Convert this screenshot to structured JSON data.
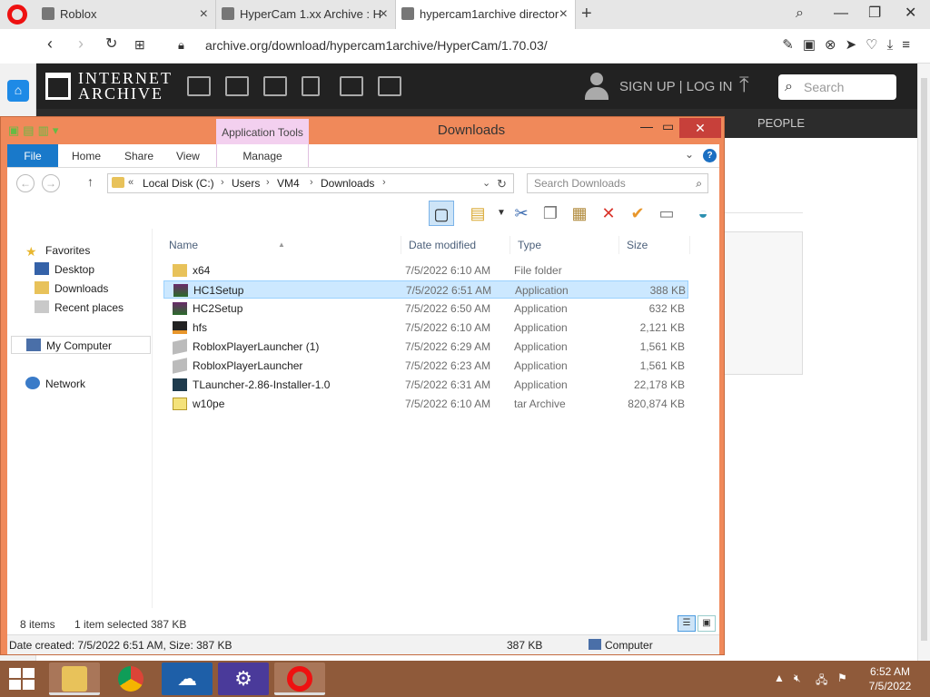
{
  "browser": {
    "tabs": [
      {
        "title": "Roblox",
        "active": false
      },
      {
        "title": "HyperCam 1.xx Archive : H",
        "active": false
      },
      {
        "title": "hypercam1archive director",
        "active": true
      }
    ],
    "url": "archive.org/download/hypercam1archive/HyperCam/1.70.03/"
  },
  "archive": {
    "logo_line1": "INTERNET",
    "logo_line2": "ARCHIVE",
    "signup": "SIGN UP | LOG IN",
    "search_placeholder": "Search",
    "people": "PEOPLE"
  },
  "explorer": {
    "title": "Downloads",
    "app_tools": "Application Tools",
    "ribbon_tabs": {
      "file": "File",
      "home": "Home",
      "share": "Share",
      "view": "View",
      "manage": "Manage"
    },
    "breadcrumb": [
      "Local Disk (C:)",
      "Users",
      "VM4",
      "Downloads"
    ],
    "search_placeholder": "Search Downloads",
    "nav": {
      "favorites": "Favorites",
      "desktop": "Desktop",
      "downloads": "Downloads",
      "recent": "Recent places",
      "computer": "My Computer",
      "network": "Network"
    },
    "columns": {
      "name": "Name",
      "date": "Date modified",
      "type": "Type",
      "size": "Size"
    },
    "files": [
      {
        "name": "x64",
        "date": "7/5/2022 6:10 AM",
        "type": "File folder",
        "size": "",
        "icon": "folder-icon",
        "selected": false
      },
      {
        "name": "HC1Setup",
        "date": "7/5/2022 6:51 AM",
        "type": "Application",
        "size": "388 KB",
        "icon": "installer-icon",
        "selected": true
      },
      {
        "name": "HC2Setup",
        "date": "7/5/2022 6:50 AM",
        "type": "Application",
        "size": "632 KB",
        "icon": "installer-icon",
        "selected": false
      },
      {
        "name": "hfs",
        "date": "7/5/2022 6:10 AM",
        "type": "Application",
        "size": "2,121 KB",
        "icon": "hfs-icon",
        "selected": false
      },
      {
        "name": "RobloxPlayerLauncher (1)",
        "date": "7/5/2022 6:29 AM",
        "type": "Application",
        "size": "1,561 KB",
        "icon": "roblox-icon",
        "selected": false
      },
      {
        "name": "RobloxPlayerLauncher",
        "date": "7/5/2022 6:23 AM",
        "type": "Application",
        "size": "1,561 KB",
        "icon": "roblox-icon",
        "selected": false
      },
      {
        "name": "TLauncher-2.86-Installer-1.0",
        "date": "7/5/2022 6:31 AM",
        "type": "Application",
        "size": "22,178 KB",
        "icon": "tlauncher-icon",
        "selected": false
      },
      {
        "name": "w10pe",
        "date": "7/5/2022 6:10 AM",
        "type": "tar Archive",
        "size": "820,874 KB",
        "icon": "archive-icon",
        "selected": false
      }
    ],
    "status": {
      "items": "8 items",
      "selected": "1 item selected",
      "size": "387 KB"
    },
    "details": {
      "created": "Date created: 7/5/2022 6:51 AM, Size: 387 KB",
      "size": "387 KB",
      "location": "Computer"
    }
  },
  "taskbar": {
    "time": "6:52 AM",
    "date": "7/5/2022"
  },
  "colors": {
    "explorer_frame": "#f0895a",
    "file_tab": "#1979ca",
    "selection": "#cce8ff",
    "taskbar": "#8f5a3a"
  }
}
